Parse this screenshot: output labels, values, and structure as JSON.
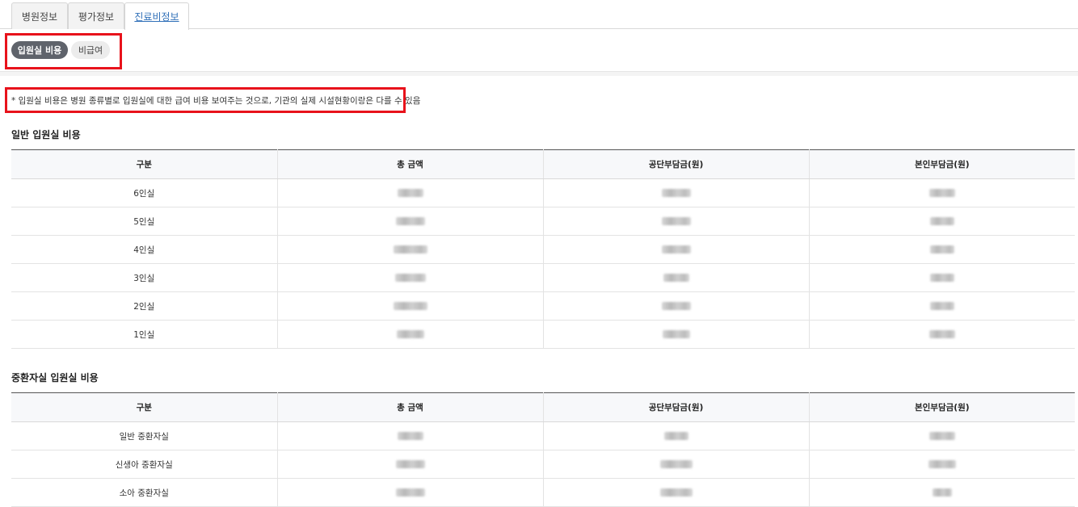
{
  "tabs": [
    {
      "label": "병원정보"
    },
    {
      "label": "평가정보"
    },
    {
      "label": "진료비정보"
    }
  ],
  "room_filter": {
    "active_label": "입원실 비용",
    "inactive_label": "비급여"
  },
  "notice": "* 입원실 비용은 병원 종류별로 입원실에 대한 급여 비용 보여주는 것으로, 기관의 실제 시설현황이랑은 다를 수 있음",
  "general_room": {
    "title": "일반 입원실 비용",
    "headers": [
      "구분",
      "총 금액",
      "공단부담금(원)",
      "본인부담금(원)"
    ],
    "rows": [
      {
        "label": "6인실"
      },
      {
        "label": "5인실"
      },
      {
        "label": "4인실"
      },
      {
        "label": "3인실"
      },
      {
        "label": "2인실"
      },
      {
        "label": "1인실"
      }
    ]
  },
  "icu_room": {
    "title": "중환자실 입원실 비용",
    "headers": [
      "구분",
      "총 금액",
      "공단부담금(원)",
      "본인부담금(원)"
    ],
    "rows": [
      {
        "label": "일반 중환자실"
      },
      {
        "label": "신생아 중환자실"
      },
      {
        "label": "소아 중환자실"
      }
    ]
  }
}
